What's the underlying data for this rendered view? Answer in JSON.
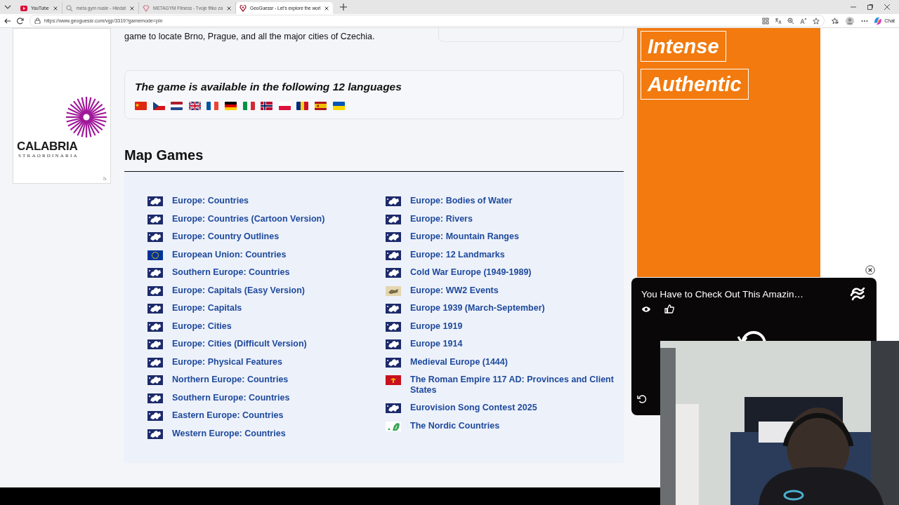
{
  "browser": {
    "tabs": [
      {
        "label": "YouTube",
        "kind": "youtube",
        "selected": false
      },
      {
        "label": "meta gym nusle - Hledat",
        "kind": "search",
        "selected": false
      },
      {
        "label": "METAGYM Fitness - Tvoje fitko za",
        "kind": "gem",
        "selected": false
      },
      {
        "label": "GeoGuessr - Let's explore the worl",
        "kind": "pin",
        "selected": true
      }
    ],
    "url": "https://www.geoguessr.com/vgp/3319?gamemode=pin",
    "chat": "Chat"
  },
  "left_ad": {
    "brand": "CALABRIA",
    "tagline": "STRAORDINARIA"
  },
  "intro": {
    "text": "game to locate Brno, Prague, and all the major cities of Czechia."
  },
  "languages": {
    "title": "The game is available in the following 12 languages"
  },
  "map_games": {
    "title": "Map Games",
    "columns": [
      {
        "items": [
          {
            "label": "Europe: Countries",
            "kind": "europe"
          },
          {
            "label": "Europe: Countries (Cartoon Version)",
            "kind": "europe"
          },
          {
            "label": "Europe: Country Outlines",
            "kind": "europe"
          },
          {
            "label": "European Union: Countries",
            "kind": "eu"
          },
          {
            "label": "Southern Europe: Countries",
            "kind": "europe"
          },
          {
            "label": "Europe: Capitals (Easy Version)",
            "kind": "europe"
          },
          {
            "label": "Europe: Capitals",
            "kind": "europe"
          },
          {
            "label": "Europe: Cities",
            "kind": "europe"
          },
          {
            "label": "Europe: Cities (Difficult Version)",
            "kind": "europe"
          },
          {
            "label": "Europe: Physical Features",
            "kind": "europe"
          },
          {
            "label": "Northern Europe: Countries",
            "kind": "europe"
          },
          {
            "label": "Southern Europe: Countries",
            "kind": "europe"
          },
          {
            "label": "Eastern Europe: Countries",
            "kind": "europe"
          },
          {
            "label": "Western Europe: Countries",
            "kind": "europe"
          }
        ]
      },
      {
        "items": [
          {
            "label": "Europe: Bodies of Water",
            "kind": "europe"
          },
          {
            "label": "Europe: Rivers",
            "kind": "europe"
          },
          {
            "label": "Europe: Mountain Ranges",
            "kind": "europe"
          },
          {
            "label": "Europe: 12 Landmarks",
            "kind": "europe"
          },
          {
            "label": "Cold War Europe (1949-1989)",
            "kind": "europe"
          },
          {
            "label": "Europe: WW2 Events",
            "kind": "ww2"
          },
          {
            "label": "Europe 1939 (March-September)",
            "kind": "europe"
          },
          {
            "label": "Europe 1919",
            "kind": "europe"
          },
          {
            "label": "Europe 1914",
            "kind": "europe"
          },
          {
            "label": "Medieval Europe (1444)",
            "kind": "europe"
          },
          {
            "label": "The Roman Empire 117 AD: Provinces and Client States",
            "kind": "roman"
          },
          {
            "label": "Eurovision Song Contest 2025",
            "kind": "europe"
          },
          {
            "label": "The Nordic Countries",
            "kind": "nordic"
          }
        ]
      }
    ]
  },
  "right_ad": {
    "words": [
      "Intense",
      "Authentic"
    ]
  },
  "video": {
    "title": "You Have to Check Out This Amazin…"
  }
}
